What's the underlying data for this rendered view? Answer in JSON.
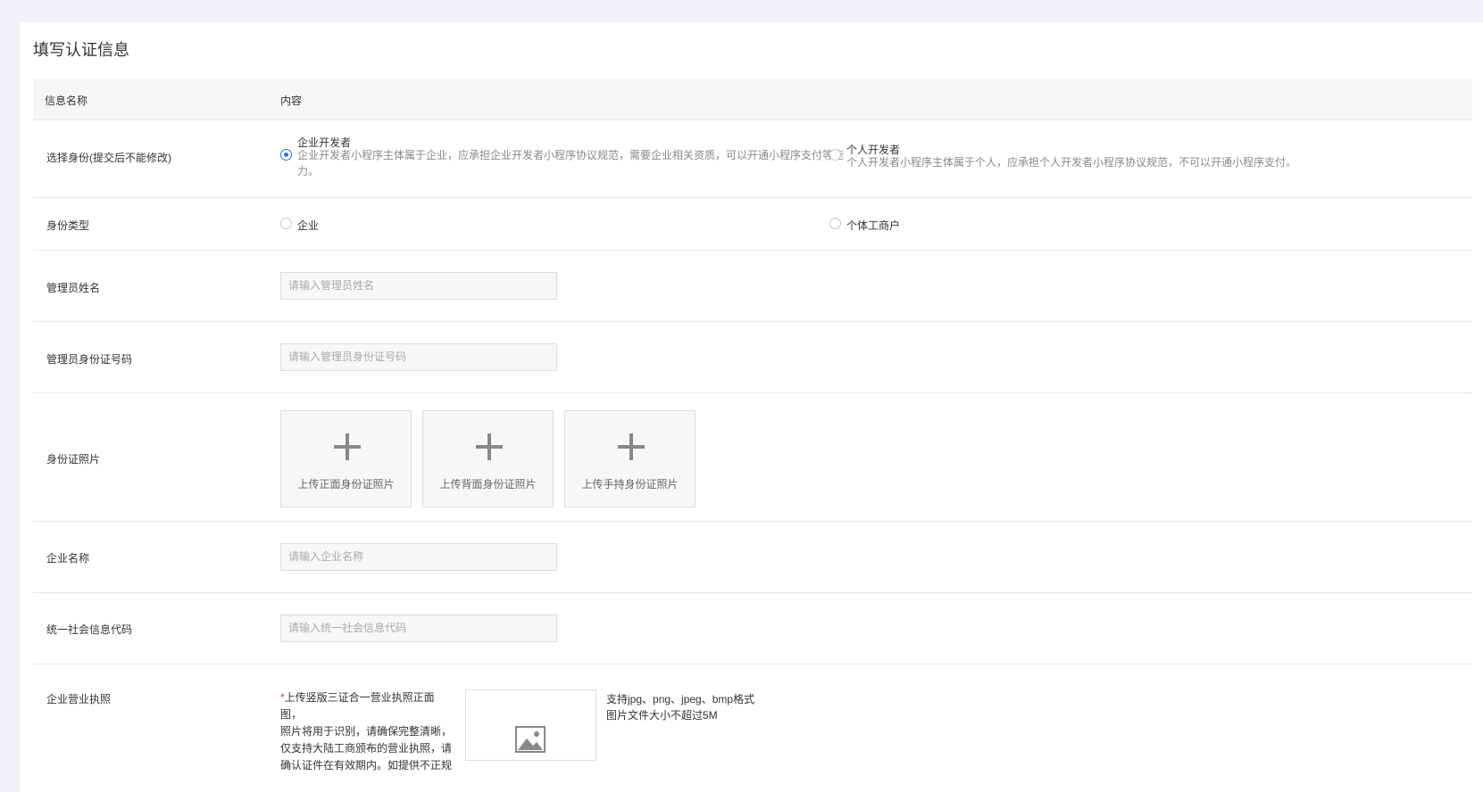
{
  "page_title": "填写认证信息",
  "table_header": {
    "col1": "信息名称",
    "col2": "内容"
  },
  "identity": {
    "label": "选择身份(提交后不能修改)",
    "options": [
      {
        "title": "企业开发者",
        "desc_line1": "企业开发者小程序主体属于企业，应承担企业开发者小程序协议规范，需要企业相关资质，可以开通小程序支付等能",
        "desc_line2": "力。",
        "checked": true
      },
      {
        "title": "个人开发者",
        "desc_line1": "个人开发者小程序主体属于个人，应承担个人开发者小程序协议规范，不可以开通小程序支付。",
        "checked": false
      }
    ]
  },
  "identity_type": {
    "label": "身份类型",
    "options": [
      {
        "title": "企业",
        "checked": false
      },
      {
        "title": "个体工商户",
        "checked": false
      }
    ]
  },
  "admin_name": {
    "label": "管理员姓名",
    "placeholder": "请输入管理员姓名"
  },
  "admin_id": {
    "label": "管理员身份证号码",
    "placeholder": "请输入管理员身份证号码"
  },
  "id_photos": {
    "label": "身份证照片",
    "uploads": [
      "上传正面身份证照片",
      "上传背面身份证照片",
      "上传手持身份证照片"
    ]
  },
  "company_name": {
    "label": "企业名称",
    "placeholder": "请输入企业名称"
  },
  "credit_code": {
    "label": "统一社会信息代码",
    "placeholder": "请输入统一社会信息代码"
  },
  "license": {
    "label": "企业营业执照",
    "required_mark": "*",
    "note_lines": [
      "上传竖版三证合一营业执照正面图，",
      "照片将用于识别，请确保完整清晰，",
      "仅支持大陆工商颁布的营业执照，请",
      "确认证件在有效期内。如提供不正规"
    ],
    "format_hint": "支持jpg、png、jpeg、bmp格式",
    "size_hint": "图片文件大小不超过5M"
  },
  "icons": {
    "upload": "plus-icon",
    "image_placeholder": "image-icon"
  },
  "colors": {
    "accent": "#2f6fe4",
    "required": "#ee3333"
  }
}
